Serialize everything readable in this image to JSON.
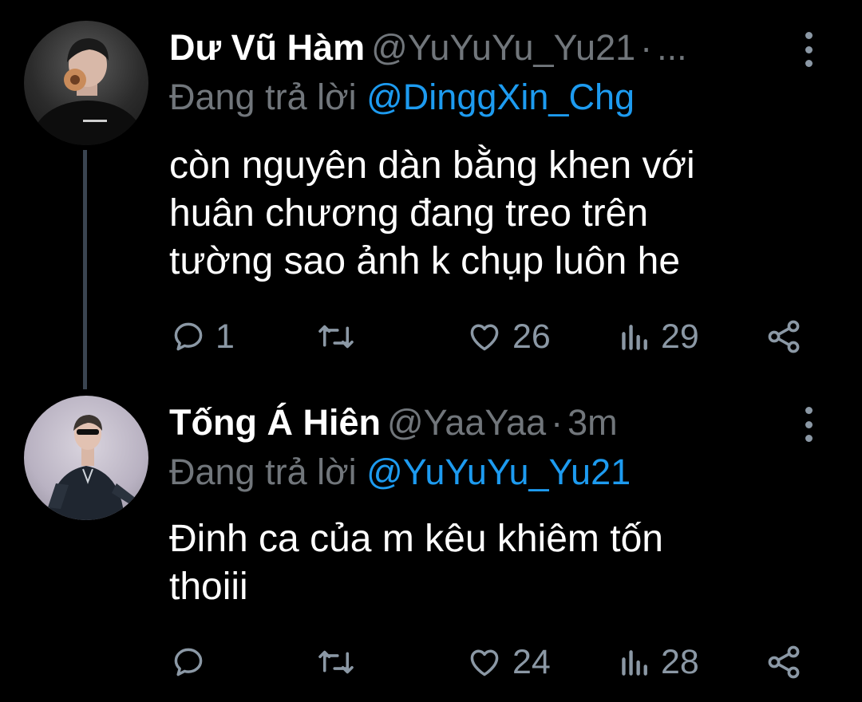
{
  "colors": {
    "background": "#000000",
    "name": "#ffffff",
    "secondary_text": "#71767b",
    "mention": "#1d9bf0",
    "icon": "#8b98a5",
    "thread_line": "#3a4450"
  },
  "tweets": [
    {
      "display_name": "Dư Vũ Hàm",
      "handle": "@YuYuYu_Yu21",
      "separator": "·",
      "time": "...",
      "reply_prefix": "Đang trả lời",
      "reply_mention": "@DinggXin_Chg",
      "text_lines": [
        "còn nguyên dàn bằng khen với",
        "huân chương đang treo trên",
        "tường sao ảnh k chụp luôn he"
      ],
      "reply_count": "1",
      "retweet_count": "",
      "like_count": "26",
      "view_count": "29",
      "icons": [
        "reply-icon",
        "retweet-icon",
        "like-icon",
        "views-icon",
        "share-icon",
        "more-options-icon"
      ]
    },
    {
      "display_name": "Tống Á Hiên",
      "handle": "@YaaYaa",
      "separator": "·",
      "time": "3m",
      "reply_prefix": "Đang trả lời",
      "reply_mention": "@YuYuYu_Yu21",
      "text_lines": [
        "Đinh ca của m kêu khiêm tốn",
        "thoiii"
      ],
      "reply_count": "",
      "retweet_count": "",
      "like_count": "24",
      "view_count": "28",
      "icons": [
        "reply-icon",
        "retweet-icon",
        "like-icon",
        "views-icon",
        "share-icon",
        "more-options-icon"
      ]
    }
  ]
}
